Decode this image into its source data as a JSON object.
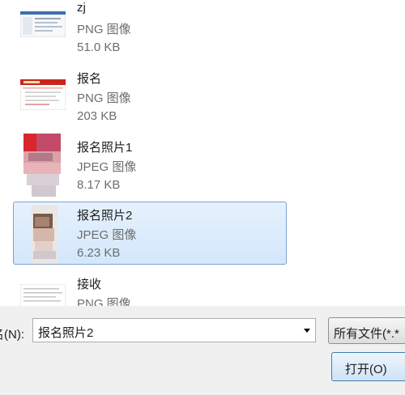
{
  "files": [
    {
      "name": "zj",
      "type": "PNG 图像",
      "size": "51.0 KB",
      "thumb": "screenshot-thumbnail"
    },
    {
      "name": "报名",
      "type": "PNG 图像",
      "size": "203 KB",
      "thumb": "webpage-thumbnail"
    },
    {
      "name": "报名照片1",
      "type": "JPEG 图像",
      "size": "8.17 KB",
      "thumb": "blurred-photo-thumbnail"
    },
    {
      "name": "报名照片2",
      "type": "JPEG 图像",
      "size": "6.23 KB",
      "thumb": "blurred-photo-thumbnail",
      "selected": true
    },
    {
      "name": "接收",
      "type": "PNG 图像",
      "size": "",
      "thumb": "document-thumbnail"
    }
  ],
  "filename": {
    "label": "名(N):",
    "value": "报名照片2"
  },
  "file_type_filter": "所有文件(*.*",
  "open_button": "打开(O)",
  "colors": {
    "selection_bg": "#d9eafb",
    "selection_border": "#7da2ce",
    "button_border": "#3c7fb1",
    "secondary_text": "#6d6d6d"
  }
}
